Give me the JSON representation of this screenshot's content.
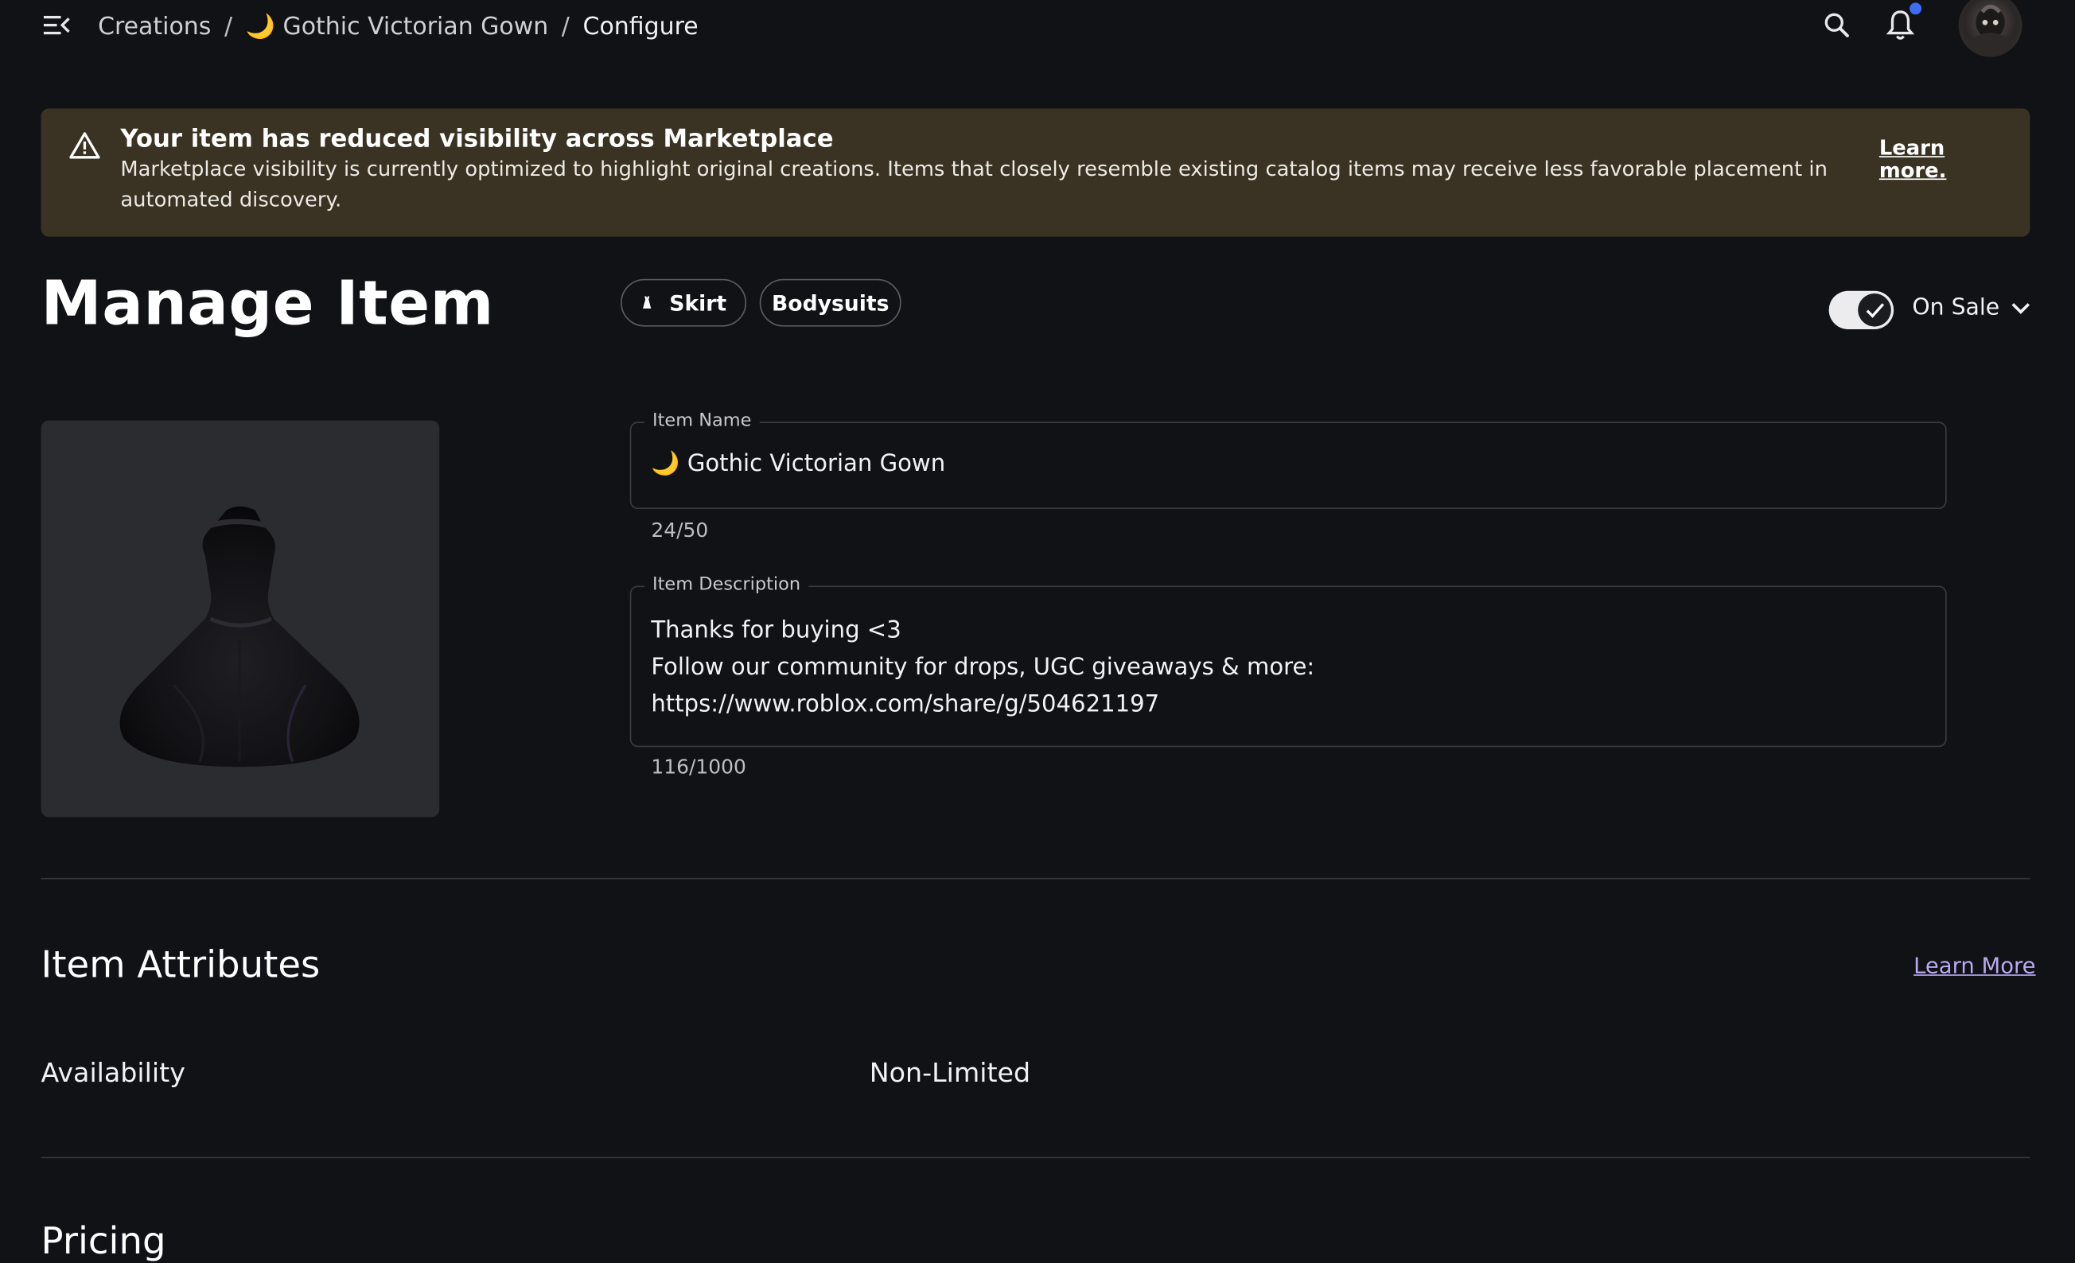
{
  "breadcrumb": {
    "root": "Creations",
    "item": "🌙 Gothic Victorian Gown",
    "current": "Configure",
    "separator": "/"
  },
  "header_icons": [
    "menu-icon",
    "search-icon",
    "bell-icon",
    "avatar"
  ],
  "banner": {
    "title": "Your item has reduced visibility across Marketplace",
    "body": "Marketplace visibility is currently optimized to highlight original creations. Items that closely resemble existing catalog items may receive less favorable placement in automated discovery.",
    "link": "Learn more.",
    "color": "#3a3222"
  },
  "page": {
    "title": "Manage Item"
  },
  "chips": {
    "skirt": "Skirt",
    "bodysuits": "Bodysuits"
  },
  "sale": {
    "toggle_on": true,
    "status": "On Sale"
  },
  "form": {
    "name_label": "Item Name",
    "name_value": "🌙 Gothic Victorian Gown",
    "name_counter": "24/50",
    "desc_label": "Item Description",
    "desc_value": "Thanks for buying <3\nFollow our community for drops, UGC giveaways & more:\nhttps://www.roblox.com/share/g/504621197",
    "desc_counter": "116/1000"
  },
  "attributes": {
    "title": "Item Attributes",
    "learn_more": "Learn More",
    "availability_label": "Availability",
    "availability_value": "Non-Limited"
  },
  "pricing": {
    "title": "Pricing"
  },
  "colors": {
    "background": "#111216",
    "accent_link": "#b9a9f0",
    "notification_dot": "#3e6cf7"
  }
}
